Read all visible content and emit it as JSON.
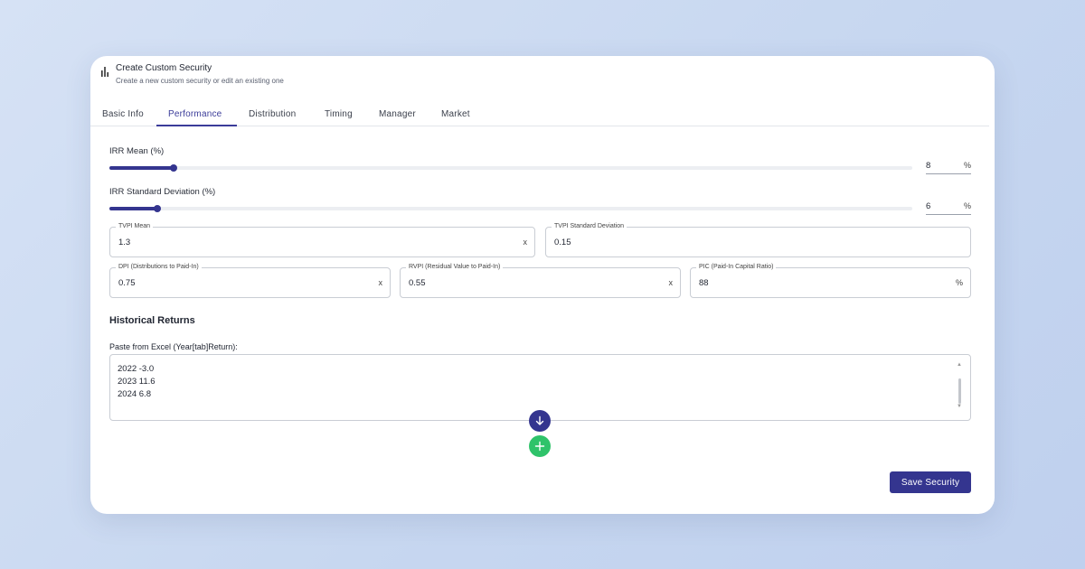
{
  "dialog": {
    "title": "Create Custom Security",
    "subtitle": "Create a new custom security or edit an existing one"
  },
  "tabs": [
    {
      "label": "Basic Info",
      "active": false
    },
    {
      "label": "Performance",
      "active": true
    },
    {
      "label": "Distribution",
      "active": false
    },
    {
      "label": "Timing",
      "active": false
    },
    {
      "label": "Manager",
      "active": false
    },
    {
      "label": "Market",
      "active": false
    }
  ],
  "performance": {
    "irr_mean": {
      "label": "IRR Mean (%)",
      "value": "8",
      "unit": "%",
      "slider_fraction": 0.08
    },
    "irr_std": {
      "label": "IRR Standard Deviation (%)",
      "value": "6",
      "unit": "%",
      "slider_fraction": 0.06
    },
    "tvpi_mean": {
      "label": "TVPI Mean",
      "value": "1.3",
      "clear": "x"
    },
    "tvpi_std": {
      "label": "TVPI Standard Deviation",
      "value": "0.15"
    },
    "dpi": {
      "label": "DPI (Distributions to Paid-In)",
      "value": "0.75",
      "clear": "x"
    },
    "rvpi": {
      "label": "RVPI (Residual Value to Paid-In)",
      "value": "0.55",
      "clear": "x"
    },
    "pic": {
      "label": "PIC (Paid-In Capital Ratio)",
      "value": "88",
      "unit": "%"
    }
  },
  "historical": {
    "title": "Historical Returns",
    "paste_label": "Paste from Excel (Year[tab]Return):",
    "lines": [
      "2022 -3.0",
      "2023 11.6",
      "2024 6.8"
    ]
  },
  "actions": {
    "save_label": "Save Security",
    "down_icon": "arrow-down-icon",
    "add_icon": "plus-icon"
  },
  "colors": {
    "primary": "#34358f",
    "success": "#2fc36a",
    "background": "#cfdcf2"
  }
}
